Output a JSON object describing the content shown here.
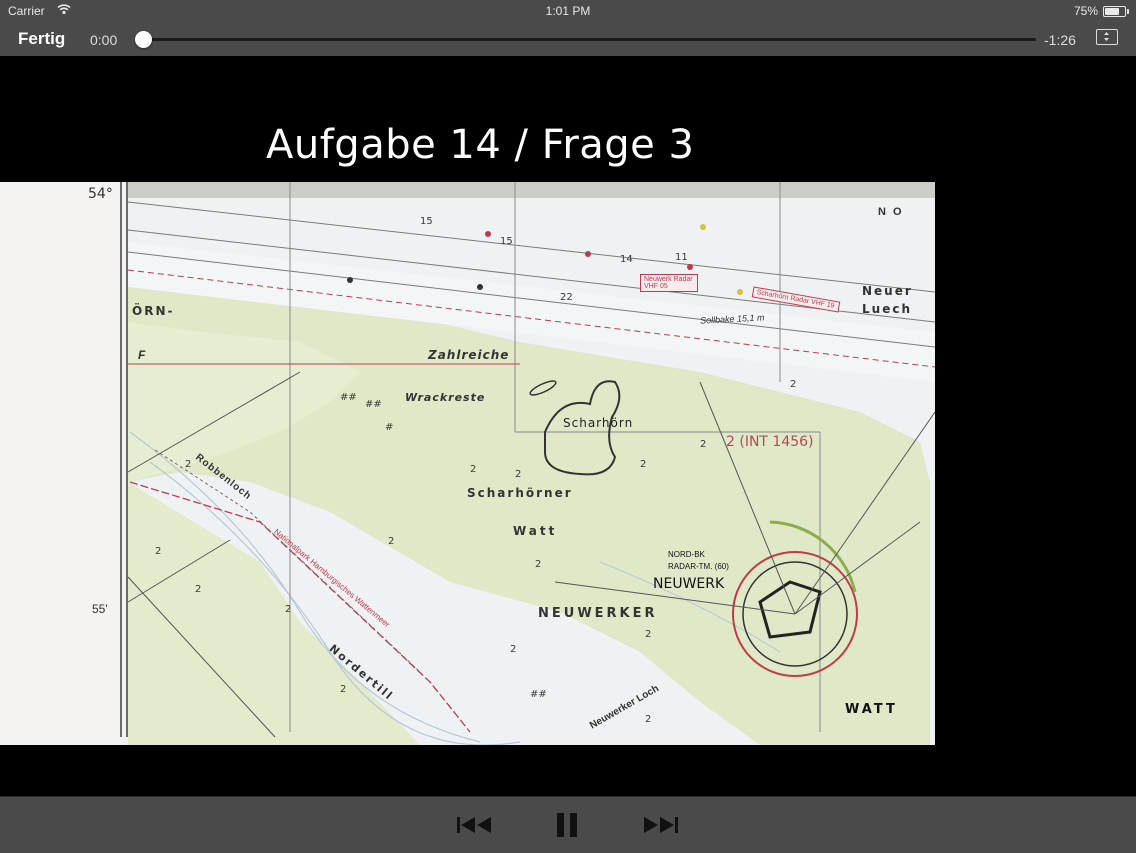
{
  "status_bar": {
    "carrier": "Carrier",
    "time": "1:01 PM",
    "battery_pct": "75%",
    "battery_level": 0.75
  },
  "player": {
    "done_label": "Fertig",
    "elapsed": "0:00",
    "remaining": "-1:26",
    "progress": 0.0
  },
  "slide": {
    "title": "Aufgabe 14 / Frage 3"
  },
  "chart": {
    "labels": {
      "lat_54": "54°",
      "lat_55": "55'",
      "orn": "ÖRN-",
      "f": "F",
      "zahlreiche": "Zahlreiche",
      "wrackreste": "Wrackreste",
      "scharhorn": "Scharhörn",
      "int": "2 (INT 1456)",
      "scharhorner": "Scharhörner",
      "watt": "Watt",
      "neuwerker": "NEUWERKER",
      "neuwerk": "NEUWERK",
      "nord_bk": "NORD-BK",
      "radar_tm": "RADAR-TM. (60)",
      "neuer": "Neuer",
      "luech": "Luech",
      "nordertill": "Nordertill",
      "robbenloch": "Robbenloch",
      "neuwerker_loch": "Neuwerker Loch",
      "watt2": "WATT",
      "no": "N O",
      "radar_vhf05": "Neuwerk Radar VHF 05",
      "radar_vhf19": "Scharhörn Radar VHF 19",
      "sollbake": "Sollbake 15,1 m",
      "nationalpark": "Nationalpark Hamburgisches Wattenmeer"
    }
  },
  "controls": {
    "prev_icon": "skip-back-icon",
    "pause_icon": "pause-icon",
    "next_icon": "skip-forward-icon"
  },
  "colors": {
    "chrome": "#4a4a4a",
    "land": "#dfe9c8",
    "water": "#eef2f4",
    "route_red": "#c23a4a"
  }
}
